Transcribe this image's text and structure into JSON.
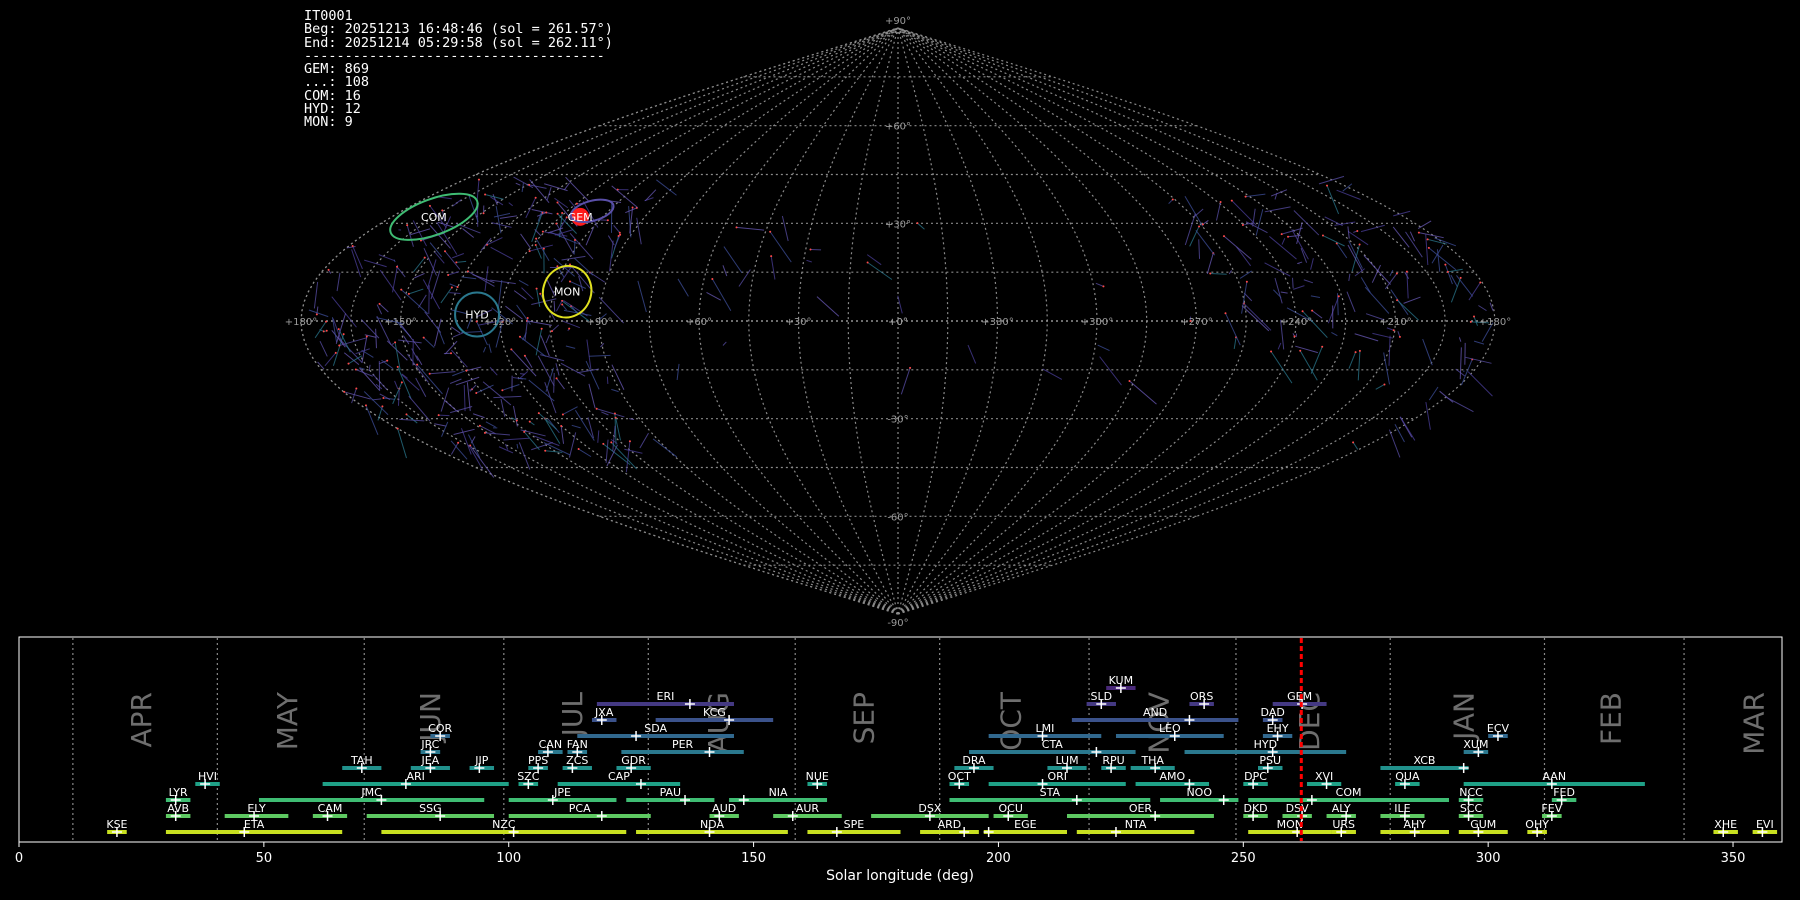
{
  "info": {
    "station": "IT0001",
    "beg": "Beg: 20251213 16:48:46 (sol = 261.57°)",
    "end": "End: 20251214 05:29:58 (sol = 262.11°)",
    "separator": "-------------------------------------",
    "counts": [
      "GEM: 869",
      "...: 108",
      "COM: 16",
      "HYD: 12",
      "MON: 9"
    ]
  },
  "sky_map": {
    "lat_labels": [
      "+90°",
      "+60°",
      "+30°",
      "+0°",
      "-30°",
      "-60°",
      "-90°"
    ],
    "lon_labels": [
      "+180°",
      "+150°",
      "+120°",
      "+90°",
      "+60°",
      "+30°",
      "+0°",
      "+330°",
      "+300°",
      "+270°",
      "+240°",
      "+210°",
      "+180°"
    ],
    "radiants": [
      {
        "name": "COM",
        "lon": 165,
        "lat": 32,
        "color": "#3fbc73"
      },
      {
        "name": "GEM",
        "lon": 113,
        "lat": 32,
        "color": "#ff2020"
      },
      {
        "name": "MON",
        "lon": 101,
        "lat": 9,
        "color": "#e0e020"
      },
      {
        "name": "HYD",
        "lon": 127,
        "lat": 2,
        "color": "#2a788e"
      }
    ]
  },
  "chart_data": {
    "type": "timeline",
    "xlabel": "Solar longitude (deg)",
    "xlim": [
      0,
      360
    ],
    "xticks": [
      0,
      50,
      100,
      150,
      200,
      250,
      300,
      350
    ],
    "current_sol": 261.84,
    "months": [
      {
        "label": "APR",
        "start": 11.0
      },
      {
        "label": "MAY",
        "start": 40.5
      },
      {
        "label": "JUN",
        "start": 70.5
      },
      {
        "label": "JUL",
        "start": 99.0
      },
      {
        "label": "AUG",
        "start": 128.5
      },
      {
        "label": "SEP",
        "start": 158.5
      },
      {
        "label": "OCT",
        "start": 188.0
      },
      {
        "label": "NOV",
        "start": 218.5
      },
      {
        "label": "DEC",
        "start": 248.5
      },
      {
        "label": "JAN",
        "start": 280.0
      },
      {
        "label": "FEB",
        "start": 311.5
      },
      {
        "label": "MAR",
        "start": 340.0
      }
    ],
    "showers": [
      {
        "code": "KUM",
        "start": 222,
        "end": 228,
        "peak": 225,
        "row": 9,
        "color": "#482878"
      },
      {
        "code": "ERI",
        "start": 118,
        "end": 146,
        "peak": 137,
        "row": 8,
        "color": "#443983"
      },
      {
        "code": "SLD",
        "start": 218,
        "end": 224,
        "peak": 221,
        "row": 8,
        "color": "#443983"
      },
      {
        "code": "ORS",
        "start": 239,
        "end": 244,
        "peak": 242,
        "row": 8,
        "color": "#443983"
      },
      {
        "code": "GEM",
        "start": 256,
        "end": 267,
        "peak": 262,
        "row": 8,
        "color": "#443983"
      },
      {
        "code": "JXA",
        "start": 117,
        "end": 122,
        "peak": 119,
        "row": 7,
        "color": "#3b528b"
      },
      {
        "code": "KCG",
        "start": 130,
        "end": 154,
        "peak": 145,
        "row": 7,
        "color": "#3b528b"
      },
      {
        "code": "AND",
        "start": 215,
        "end": 249,
        "peak": 239,
        "row": 7,
        "color": "#3b528b"
      },
      {
        "code": "DAD",
        "start": 254,
        "end": 258,
        "peak": 256,
        "row": 7,
        "color": "#3b528b"
      },
      {
        "code": "COR",
        "start": 84,
        "end": 88,
        "peak": 86,
        "row": 6,
        "color": "#31688e"
      },
      {
        "code": "SDA",
        "start": 114,
        "end": 146,
        "peak": 126,
        "row": 6,
        "color": "#31688e"
      },
      {
        "code": "LMI",
        "start": 198,
        "end": 221,
        "peak": 209,
        "row": 6,
        "color": "#31688e"
      },
      {
        "code": "LEO",
        "start": 224,
        "end": 246,
        "peak": 236,
        "row": 6,
        "color": "#31688e"
      },
      {
        "code": "EHY",
        "start": 254,
        "end": 260,
        "peak": 257,
        "row": 6,
        "color": "#31688e"
      },
      {
        "code": "ECV",
        "start": 300,
        "end": 304,
        "peak": 302,
        "row": 6,
        "color": "#31688e"
      },
      {
        "code": "JRC",
        "start": 82,
        "end": 86,
        "peak": 84,
        "row": 5,
        "color": "#2a788e"
      },
      {
        "code": "CAN",
        "start": 106,
        "end": 111,
        "peak": 108,
        "row": 5,
        "color": "#2a788e"
      },
      {
        "code": "FAN",
        "start": 112,
        "end": 116,
        "peak": 114,
        "row": 5,
        "color": "#2a788e"
      },
      {
        "code": "PER",
        "start": 123,
        "end": 148,
        "peak": 141,
        "row": 5,
        "color": "#2a788e"
      },
      {
        "code": "CTA",
        "start": 194,
        "end": 228,
        "peak": 220,
        "row": 5,
        "color": "#2a788e"
      },
      {
        "code": "HYD",
        "start": 238,
        "end": 271,
        "peak": 256,
        "row": 5,
        "color": "#2a788e"
      },
      {
        "code": "XUM",
        "start": 295,
        "end": 300,
        "peak": 298,
        "row": 5,
        "color": "#2a788e"
      },
      {
        "code": "TAH",
        "start": 66,
        "end": 74,
        "peak": 70,
        "row": 4,
        "color": "#21918c"
      },
      {
        "code": "JEA",
        "start": 80,
        "end": 88,
        "peak": 84,
        "row": 4,
        "color": "#21918c"
      },
      {
        "code": "JIP",
        "start": 92,
        "end": 97,
        "peak": 94,
        "row": 4,
        "color": "#21918c"
      },
      {
        "code": "PPS",
        "start": 104,
        "end": 108,
        "peak": 106,
        "row": 4,
        "color": "#21918c"
      },
      {
        "code": "ZCS",
        "start": 111,
        "end": 117,
        "peak": 113,
        "row": 4,
        "color": "#21918c"
      },
      {
        "code": "GDR",
        "start": 122,
        "end": 129,
        "peak": 125,
        "row": 4,
        "color": "#21918c"
      },
      {
        "code": "DRA",
        "start": 191,
        "end": 199,
        "peak": 195,
        "row": 4,
        "color": "#21918c"
      },
      {
        "code": "LUM",
        "start": 210,
        "end": 218,
        "peak": 214,
        "row": 4,
        "color": "#21918c"
      },
      {
        "code": "RPU",
        "start": 221,
        "end": 226,
        "peak": 223,
        "row": 4,
        "color": "#21918c"
      },
      {
        "code": "THA",
        "start": 227,
        "end": 236,
        "peak": 232,
        "row": 4,
        "color": "#21918c"
      },
      {
        "code": "PSU",
        "start": 253,
        "end": 258,
        "peak": 255,
        "row": 4,
        "color": "#21918c"
      },
      {
        "code": "XCB",
        "start": 278,
        "end": 296,
        "peak": 295,
        "row": 4,
        "color": "#21918c"
      },
      {
        "code": "HVI",
        "start": 36,
        "end": 41,
        "peak": 38,
        "row": 3,
        "color": "#1fa187"
      },
      {
        "code": "ARI",
        "start": 62,
        "end": 100,
        "peak": 79,
        "row": 3,
        "color": "#1fa187"
      },
      {
        "code": "SZC",
        "start": 102,
        "end": 106,
        "peak": 104,
        "row": 3,
        "color": "#1fa187"
      },
      {
        "code": "CAP",
        "start": 110,
        "end": 135,
        "peak": 127,
        "row": 3,
        "color": "#1fa187"
      },
      {
        "code": "NUE",
        "start": 161,
        "end": 165,
        "peak": 163,
        "row": 3,
        "color": "#1fa187"
      },
      {
        "code": "OCT",
        "start": 190,
        "end": 194,
        "peak": 192,
        "row": 3,
        "color": "#1fa187"
      },
      {
        "code": "ORI",
        "start": 198,
        "end": 226,
        "peak": 209,
        "row": 3,
        "color": "#1fa187"
      },
      {
        "code": "AMO",
        "start": 228,
        "end": 243,
        "peak": 239,
        "row": 3,
        "color": "#1fa187"
      },
      {
        "code": "DPC",
        "start": 250,
        "end": 255,
        "peak": 252,
        "row": 3,
        "color": "#1fa187"
      },
      {
        "code": "XVI",
        "start": 263,
        "end": 270,
        "peak": 267,
        "row": 3,
        "color": "#1fa187"
      },
      {
        "code": "QUA",
        "start": 281,
        "end": 286,
        "peak": 283,
        "row": 3,
        "color": "#1fa187"
      },
      {
        "code": "AAN",
        "start": 295,
        "end": 332,
        "peak": 313,
        "row": 3,
        "color": "#1fa187"
      },
      {
        "code": "LYR",
        "start": 30,
        "end": 35,
        "peak": 32,
        "row": 2,
        "color": "#3fbc73"
      },
      {
        "code": "JMC",
        "start": 49,
        "end": 95,
        "peak": 74,
        "row": 2,
        "color": "#3fbc73"
      },
      {
        "code": "JPE",
        "start": 100,
        "end": 122,
        "peak": 109,
        "row": 2,
        "color": "#3fbc73"
      },
      {
        "code": "PAU",
        "start": 124,
        "end": 142,
        "peak": 136,
        "row": 2,
        "color": "#3fbc73"
      },
      {
        "code": "NIA",
        "start": 145,
        "end": 165,
        "peak": 148,
        "row": 2,
        "color": "#3fbc73"
      },
      {
        "code": "STA",
        "start": 190,
        "end": 231,
        "peak": 216,
        "row": 2,
        "color": "#3fbc73"
      },
      {
        "code": "NOO",
        "start": 233,
        "end": 249,
        "peak": 246,
        "row": 2,
        "color": "#3fbc73"
      },
      {
        "code": "COM",
        "start": 251,
        "end": 292,
        "peak": 264,
        "row": 2,
        "color": "#3fbc73"
      },
      {
        "code": "NCC",
        "start": 294,
        "end": 299,
        "peak": 296,
        "row": 2,
        "color": "#3fbc73"
      },
      {
        "code": "FED",
        "start": 313,
        "end": 318,
        "peak": 315,
        "row": 2,
        "color": "#3fbc73"
      },
      {
        "code": "AVB",
        "start": 30,
        "end": 35,
        "peak": 32,
        "row": 1,
        "color": "#5ec962"
      },
      {
        "code": "ELY",
        "start": 42,
        "end": 55,
        "peak": 48,
        "row": 1,
        "color": "#5ec962"
      },
      {
        "code": "CAM",
        "start": 60,
        "end": 67,
        "peak": 63,
        "row": 1,
        "color": "#5ec962"
      },
      {
        "code": "SSG",
        "start": 71,
        "end": 97,
        "peak": 86,
        "row": 1,
        "color": "#5ec962"
      },
      {
        "code": "PCA",
        "start": 100,
        "end": 129,
        "peak": 119,
        "row": 1,
        "color": "#5ec962"
      },
      {
        "code": "AUD",
        "start": 141,
        "end": 147,
        "peak": 143,
        "row": 1,
        "color": "#5ec962"
      },
      {
        "code": "AUR",
        "start": 154,
        "end": 168,
        "peak": 158,
        "row": 1,
        "color": "#5ec962"
      },
      {
        "code": "DSX",
        "start": 174,
        "end": 198,
        "peak": 186,
        "row": 1,
        "color": "#5ec962"
      },
      {
        "code": "OCU",
        "start": 199,
        "end": 206,
        "peak": 202,
        "row": 1,
        "color": "#5ec962"
      },
      {
        "code": "OER",
        "start": 214,
        "end": 244,
        "peak": 232,
        "row": 1,
        "color": "#5ec962"
      },
      {
        "code": "DKD",
        "start": 250,
        "end": 255,
        "peak": 252,
        "row": 1,
        "color": "#5ec962"
      },
      {
        "code": "DSV",
        "start": 258,
        "end": 264,
        "peak": 262,
        "row": 1,
        "color": "#5ec962"
      },
      {
        "code": "ALY",
        "start": 267,
        "end": 273,
        "peak": 271,
        "row": 1,
        "color": "#5ec962"
      },
      {
        "code": "ILE",
        "start": 278,
        "end": 287,
        "peak": 283,
        "row": 1,
        "color": "#5ec962"
      },
      {
        "code": "SCC",
        "start": 294,
        "end": 299,
        "peak": 296,
        "row": 1,
        "color": "#5ec962"
      },
      {
        "code": "FEV",
        "start": 311,
        "end": 315,
        "peak": 313,
        "row": 1,
        "color": "#5ec962"
      },
      {
        "code": "KSE",
        "start": 18,
        "end": 22,
        "peak": 20,
        "row": 0,
        "color": "#c8e020"
      },
      {
        "code": "ETA",
        "start": 30,
        "end": 66,
        "peak": 46,
        "row": 0,
        "color": "#c8e020"
      },
      {
        "code": "NZC",
        "start": 74,
        "end": 124,
        "peak": 101,
        "row": 0,
        "color": "#c8e020"
      },
      {
        "code": "NDA",
        "start": 126,
        "end": 157,
        "peak": 141,
        "row": 0,
        "color": "#c8e020"
      },
      {
        "code": "SPE",
        "start": 161,
        "end": 180,
        "peak": 167,
        "row": 0,
        "color": "#c8e020"
      },
      {
        "code": "ARD",
        "start": 184,
        "end": 196,
        "peak": 193,
        "row": 0,
        "color": "#c8e020"
      },
      {
        "code": "EGE",
        "start": 197,
        "end": 214,
        "peak": 198,
        "row": 0,
        "color": "#c8e020"
      },
      {
        "code": "NTA",
        "start": 216,
        "end": 240,
        "peak": 224,
        "row": 0,
        "color": "#c8e020"
      },
      {
        "code": "MON",
        "start": 251,
        "end": 268,
        "peak": 261,
        "row": 0,
        "color": "#c8e020"
      },
      {
        "code": "URS",
        "start": 268,
        "end": 273,
        "peak": 270,
        "row": 0,
        "color": "#c8e020"
      },
      {
        "code": "AHY",
        "start": 278,
        "end": 292,
        "peak": 285,
        "row": 0,
        "color": "#c8e020"
      },
      {
        "code": "GUM",
        "start": 294,
        "end": 304,
        "peak": 298,
        "row": 0,
        "color": "#c8e020"
      },
      {
        "code": "OHY",
        "start": 308,
        "end": 312,
        "peak": 310,
        "row": 0,
        "color": "#c8e020"
      },
      {
        "code": "XHE",
        "start": 346,
        "end": 351,
        "peak": 348,
        "row": 0,
        "color": "#c8e020"
      },
      {
        "code": "EVI",
        "start": 354,
        "end": 359,
        "peak": 356,
        "row": 0,
        "color": "#c8e020"
      }
    ]
  }
}
